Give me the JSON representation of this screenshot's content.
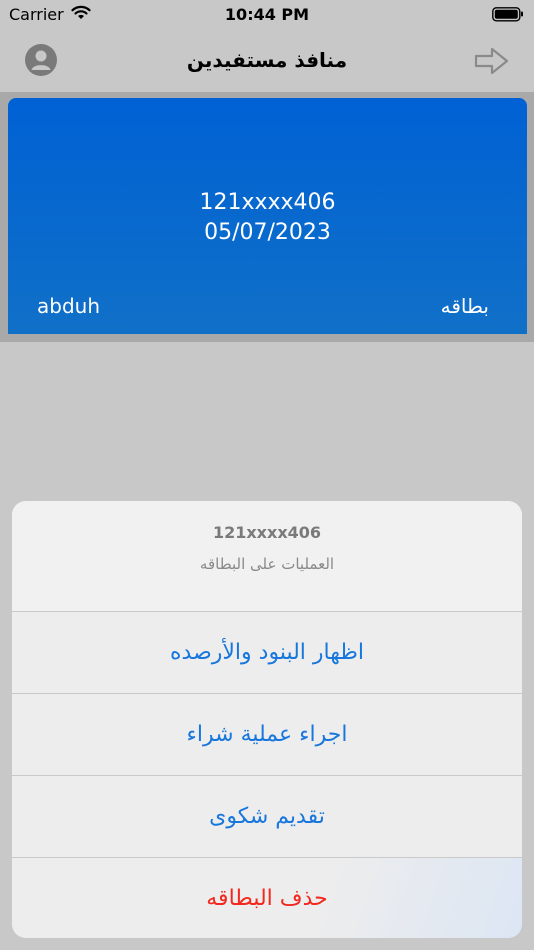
{
  "status": {
    "carrier": "Carrier",
    "time": "10:44 PM"
  },
  "nav": {
    "title": "منافذ مستفيدين"
  },
  "card": {
    "number": "121xxxx406",
    "date": "05/07/2023",
    "holder": "abduh",
    "type": "بطاقه"
  },
  "sheet": {
    "title": "121xxxx406",
    "message": "العمليات على البطاقه",
    "actions": [
      {
        "label": "اظهار البنود والأرصده"
      },
      {
        "label": "اجراء عملية شراء"
      },
      {
        "label": "تقديم شكوى"
      },
      {
        "label": "حذف البطاقه"
      }
    ]
  },
  "colors": {
    "action": "#1877dc",
    "destructive": "#f2281e",
    "card": "#0061d4"
  }
}
